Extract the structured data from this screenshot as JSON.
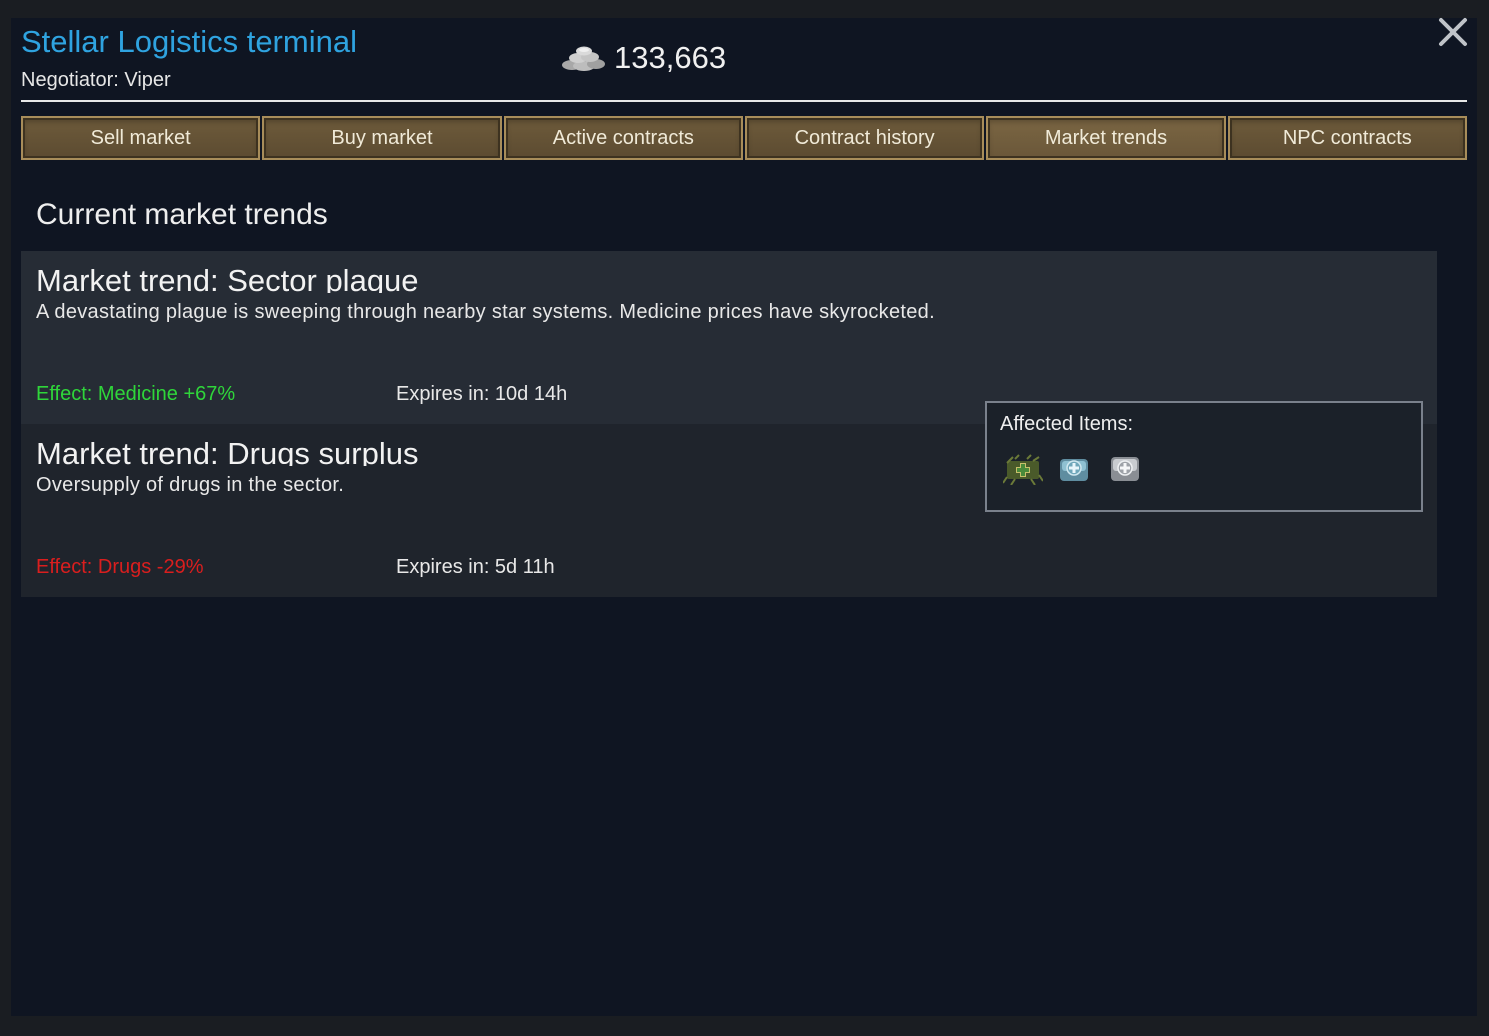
{
  "header": {
    "title": "Stellar Logistics terminal",
    "negotiator": "Negotiator: Viper",
    "silver_icon": "silver-coins-icon",
    "silver_amount": "133,663",
    "close_icon": "close-icon"
  },
  "tabs": [
    {
      "label": "Sell market"
    },
    {
      "label": "Buy market"
    },
    {
      "label": "Active contracts"
    },
    {
      "label": "Contract history"
    },
    {
      "label": "Market trends",
      "active": true
    },
    {
      "label": "NPC contracts"
    }
  ],
  "section_title": "Current market trends",
  "trends": [
    {
      "title": "Market trend: Sector plague",
      "description": "A devastating plague is sweeping through nearby star systems. Medicine prices have skyrocketed.",
      "effect": "Effect: Medicine +67%",
      "effect_color": "#2fd63a",
      "expires": "Expires in: 10d 14h"
    },
    {
      "title": "Market trend: Drugs surplus",
      "description": "Oversupply of drugs in the sector.",
      "effect": "Effect: Drugs -29%",
      "effect_color": "#d91e1e",
      "expires": "Expires in: 5d 11h"
    }
  ],
  "tooltip": {
    "title": "Affected Items:",
    "items": [
      "herbal-medicine-icon",
      "industrial-medicine-icon",
      "glitterworld-medicine-icon"
    ]
  },
  "colors": {
    "title_blue": "#2fa3e0",
    "panel_bg": "#0f1522",
    "tab_brown": "#6e5b3b"
  }
}
